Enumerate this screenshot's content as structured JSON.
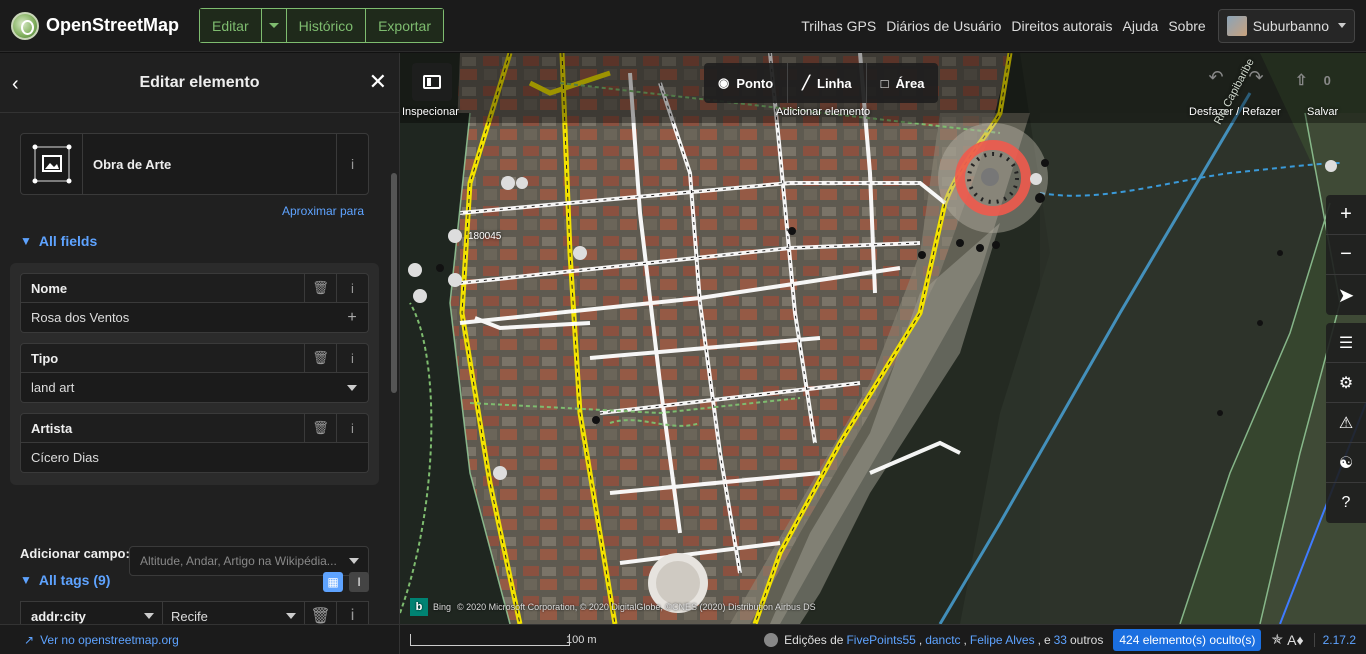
{
  "header": {
    "logo_text": "OpenStreetMap",
    "edit_label": "Editar",
    "history_label": "Histórico",
    "export_label": "Exportar",
    "nav": [
      "Trilhas GPS",
      "Diários de Usuário",
      "Direitos autorais",
      "Ajuda",
      "Sobre"
    ],
    "username": "Suburbanno"
  },
  "sidebar": {
    "title": "Editar elemento",
    "preset_name": "Obra de Arte",
    "zoom_link": "Aproximar para",
    "all_fields_label": "All fields",
    "fields": [
      {
        "label": "Nome",
        "value": "Rosa dos Ventos"
      },
      {
        "label": "Tipo",
        "value": "land art"
      },
      {
        "label": "Artista",
        "value": "Cícero Dias"
      }
    ],
    "add_field_label": "Adicionar campo:",
    "add_field_placeholder": "Altitude, Andar, Artigo na Wikipédia...",
    "all_tags_label": "All tags (9)",
    "tag_key": "addr:city",
    "tag_value": "Recife",
    "view_on_osm": "Ver no openstreetmap.org"
  },
  "map": {
    "inspect_label": "Inspecionar",
    "modes": [
      "Ponto",
      "Linha",
      "Área"
    ],
    "add_element_label": "Adicionar elemento",
    "undo_redo_label": "Desfazer / Refazer",
    "save_label": "Salvar",
    "save_count": "0",
    "bus_stop_label": "180045",
    "river_label": "Rio Capibaribe",
    "imagery_attribution": "© 2020 Microsoft Corporation, © 2020 DigitalGlobe, ©CNES (2020) Distribution Airbus DS",
    "bing_label": "Bing"
  },
  "footer": {
    "scale_label": "100 m",
    "edits_prefix": "Edições de",
    "editors": [
      "FivePoints55",
      "danctc",
      "Felipe Alves"
    ],
    "and_label": "e",
    "others_count": "33",
    "others_label": "outros",
    "hidden_badge": "424 elemento(s) oculto(s)",
    "version": "2.17.2"
  },
  "colors": {
    "accent_green": "#7ebc6f",
    "link_blue": "#5ea3ff",
    "hidden_badge": "#1b6fe0"
  }
}
